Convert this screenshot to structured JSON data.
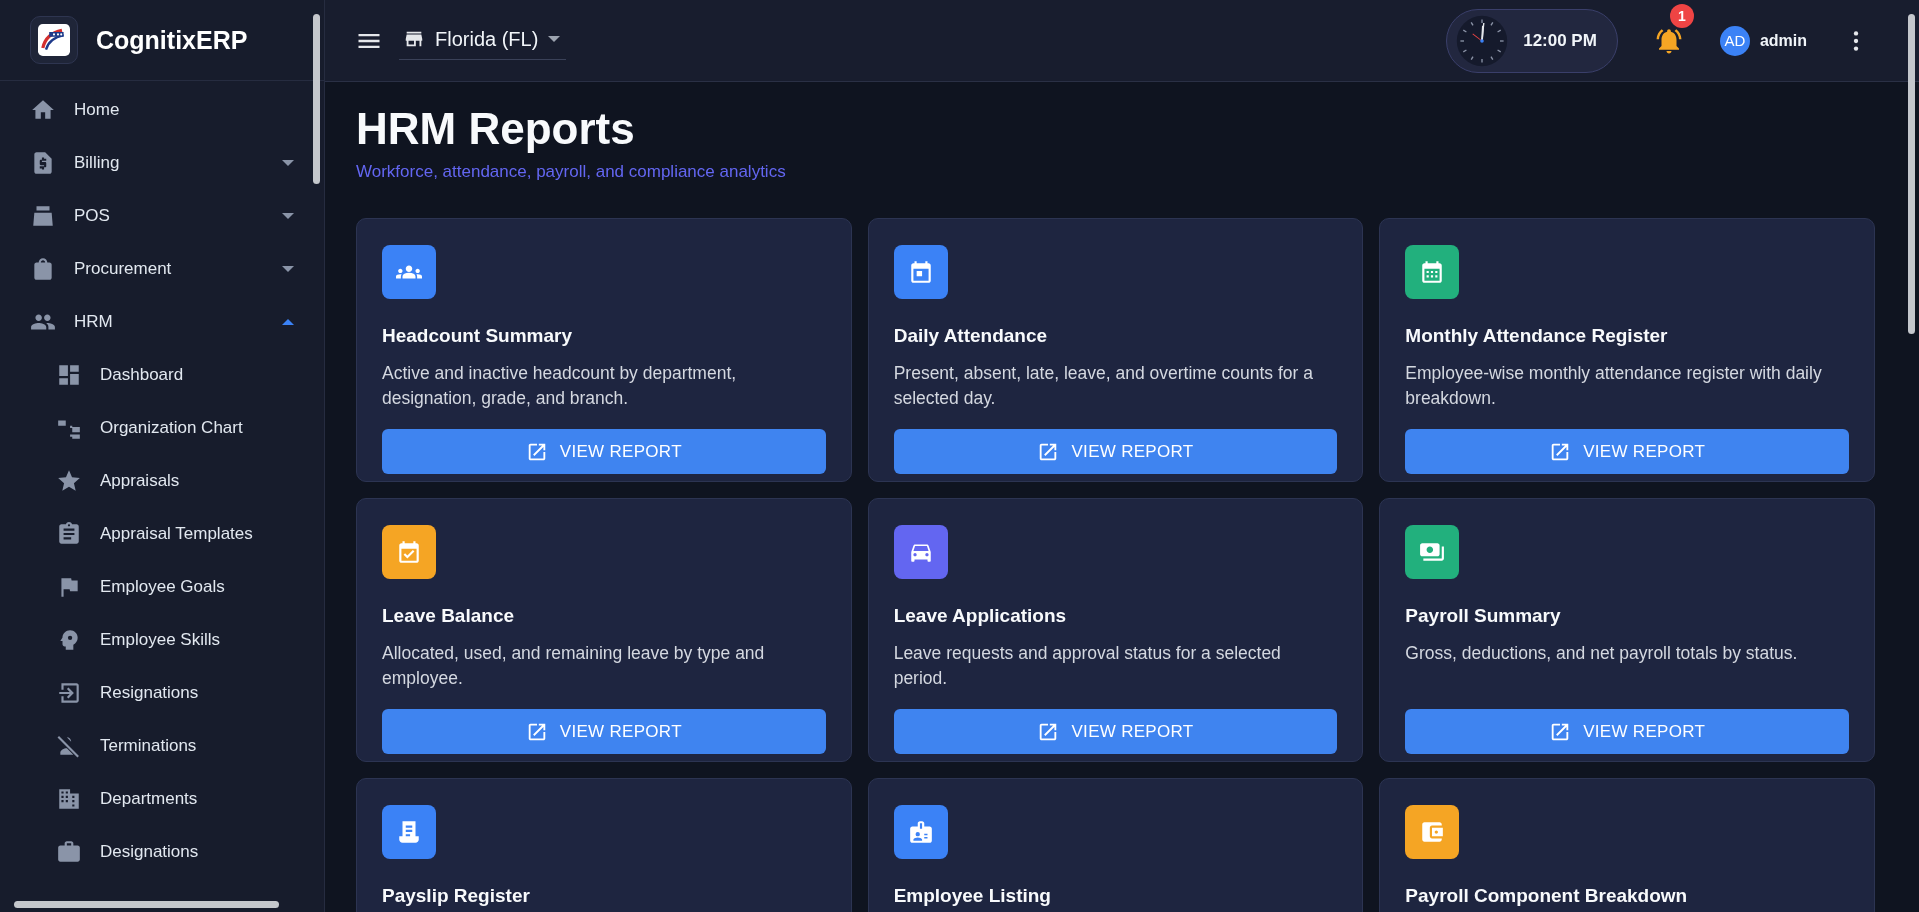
{
  "app": {
    "name": "CognitixERP"
  },
  "sidebar": {
    "items": [
      {
        "label": "Home",
        "expandable": false
      },
      {
        "label": "Billing",
        "expandable": true,
        "expanded": false
      },
      {
        "label": "POS",
        "expandable": true,
        "expanded": false
      },
      {
        "label": "Procurement",
        "expandable": true,
        "expanded": false
      },
      {
        "label": "HRM",
        "expandable": true,
        "expanded": true,
        "children": [
          {
            "label": "Dashboard"
          },
          {
            "label": "Organization Chart"
          },
          {
            "label": "Appraisals"
          },
          {
            "label": "Appraisal Templates"
          },
          {
            "label": "Employee Goals"
          },
          {
            "label": "Employee Skills"
          },
          {
            "label": "Resignations"
          },
          {
            "label": "Terminations"
          },
          {
            "label": "Departments"
          },
          {
            "label": "Designations"
          }
        ]
      }
    ]
  },
  "topbar": {
    "branch": "Florida (FL)",
    "time": "12:00 PM",
    "notification_count": "1",
    "avatar_initials": "AD",
    "user": "admin"
  },
  "page": {
    "title": "HRM Reports",
    "subtitle": "Workforce, attendance, payroll, and compliance analytics"
  },
  "reports": [
    {
      "title": "Headcount Summary",
      "description": "Active and inactive headcount by department, designation, grade, and branch.",
      "button": "VIEW REPORT",
      "color": "#3b82f6"
    },
    {
      "title": "Daily Attendance",
      "description": "Present, absent, late, leave, and overtime counts for a selected day.",
      "button": "VIEW REPORT",
      "color": "#3b82f6"
    },
    {
      "title": "Monthly Attendance Register",
      "description": "Employee-wise monthly attendance register with daily breakdown.",
      "button": "VIEW REPORT",
      "color": "#22b07d"
    },
    {
      "title": "Leave Balance",
      "description": "Allocated, used, and remaining leave by type and employee.",
      "button": "VIEW REPORT",
      "color": "#f5a524"
    },
    {
      "title": "Leave Applications",
      "description": "Leave requests and approval status for a selected period.",
      "button": "VIEW REPORT",
      "color": "#6366f1"
    },
    {
      "title": "Payroll Summary",
      "description": "Gross, deductions, and net payroll totals by status.",
      "button": "VIEW REPORT",
      "color": "#22b07d"
    },
    {
      "title": "Payslip Register",
      "color": "#3b82f6"
    },
    {
      "title": "Employee Listing",
      "color": "#3b82f6"
    },
    {
      "title": "Payroll Component Breakdown",
      "color": "#f5a524"
    }
  ]
}
